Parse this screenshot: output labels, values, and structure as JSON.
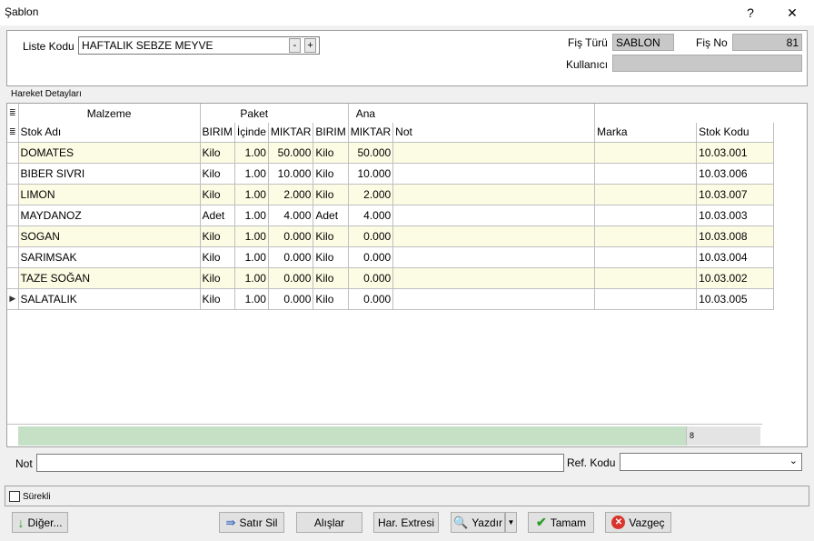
{
  "window": {
    "title": "Şablon",
    "help_label": "?",
    "close_label": "✕"
  },
  "header": {
    "liste_kodu_label": "Liste Kodu",
    "liste_kodu_value": "HAFTALIK SEBZE MEYVE",
    "minus_label": "-",
    "plus_label": "+",
    "fis_turu_label": "Fiş Türü",
    "fis_turu_value": "SABLON",
    "fis_no_label": "Fiş No",
    "fis_no_value": "81",
    "kullanici_label": "Kullanıcı",
    "kullanici_value": ""
  },
  "section_label": "Hareket Detayları",
  "grid": {
    "group_headers": {
      "malzeme": "Malzeme",
      "paket": "Paket",
      "ana": "Ana"
    },
    "columns": [
      "Stok Adı",
      "BIRIM",
      "İçinde",
      "MIKTAR",
      "BIRIM",
      "MIKTAR",
      "Not",
      "Marka",
      "Stok Kodu"
    ],
    "rows": [
      [
        "DOMATES",
        "Kilo",
        "1.00",
        "50.000",
        "Kilo",
        "50.000",
        "",
        "",
        "10.03.001"
      ],
      [
        "BIBER SIVRI",
        "Kilo",
        "1.00",
        "10.000",
        "Kilo",
        "10.000",
        "",
        "",
        "10.03.006"
      ],
      [
        "LIMON",
        "Kilo",
        "1.00",
        "2.000",
        "Kilo",
        "2.000",
        "",
        "",
        "10.03.007"
      ],
      [
        "MAYDANOZ",
        "Adet",
        "1.00",
        "4.000",
        "Adet",
        "4.000",
        "",
        "",
        "10.03.003"
      ],
      [
        "SOGAN",
        "Kilo",
        "1.00",
        "0.000",
        "Kilo",
        "0.000",
        "",
        "",
        "10.03.008"
      ],
      [
        "SARIMSAK",
        "Kilo",
        "1.00",
        "0.000",
        "Kilo",
        "0.000",
        "",
        "",
        "10.03.004"
      ],
      [
        "TAZE SOĞAN",
        "Kilo",
        "1.00",
        "0.000",
        "Kilo",
        "0.000",
        "",
        "",
        "10.03.002"
      ],
      [
        "SALATALIK",
        "Kilo",
        "1.00",
        "0.000",
        "Kilo",
        "0.000",
        "",
        "",
        "10.03.005"
      ]
    ],
    "row_count": "8"
  },
  "bottom": {
    "not_label": "Not",
    "not_value": "",
    "ref_kodu_label": "Ref. Kodu",
    "ref_kodu_value": "",
    "surekli_label": "Sürekli"
  },
  "buttons": {
    "diger": "Diğer...",
    "satir_sil": "Satır Sil",
    "alislar": "Alışlar",
    "har_extresi": "Har. Extresi",
    "yazdir": "Yazdır",
    "tamam": "Tamam",
    "vazgec": "Vazgeç"
  },
  "colors": {
    "row_alt": "#fcfce4",
    "footer_green": "#c5e0c5",
    "accent_green": "#2a9d2a",
    "cancel_red": "#d9342b"
  }
}
